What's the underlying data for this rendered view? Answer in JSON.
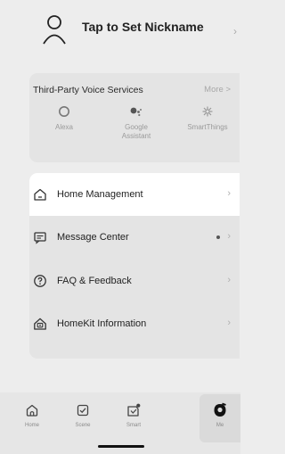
{
  "profile": {
    "nickname": "Tap to Set Nickname"
  },
  "voice_services": {
    "title": "Third-Party Voice Services",
    "more": "More >",
    "services": [
      {
        "label": "Alexa",
        "icon": "alexa-icon"
      },
      {
        "label": "Google\nAssistant",
        "icon": "google-assistant-icon"
      },
      {
        "label": "SmartThings",
        "icon": "smartthings-icon"
      }
    ]
  },
  "menu": {
    "items": [
      {
        "label": "Home Management",
        "icon": "home-icon"
      },
      {
        "label": "Message Center",
        "icon": "message-icon"
      },
      {
        "label": "FAQ & Feedback",
        "icon": "help-icon"
      },
      {
        "label": "HomeKit Information",
        "icon": "homekit-icon"
      }
    ]
  },
  "tabbar": {
    "tabs": [
      {
        "label": "Home",
        "icon": "home-tab-icon"
      },
      {
        "label": "Scene",
        "icon": "scene-tab-icon"
      },
      {
        "label": "Smart",
        "icon": "smart-tab-icon"
      },
      {
        "label": "Me",
        "icon": "me-tab-icon",
        "selected": true
      }
    ]
  },
  "colors": {
    "background": "#ededed",
    "card": "#e4e4e4",
    "selected_row": "#ffffff"
  }
}
